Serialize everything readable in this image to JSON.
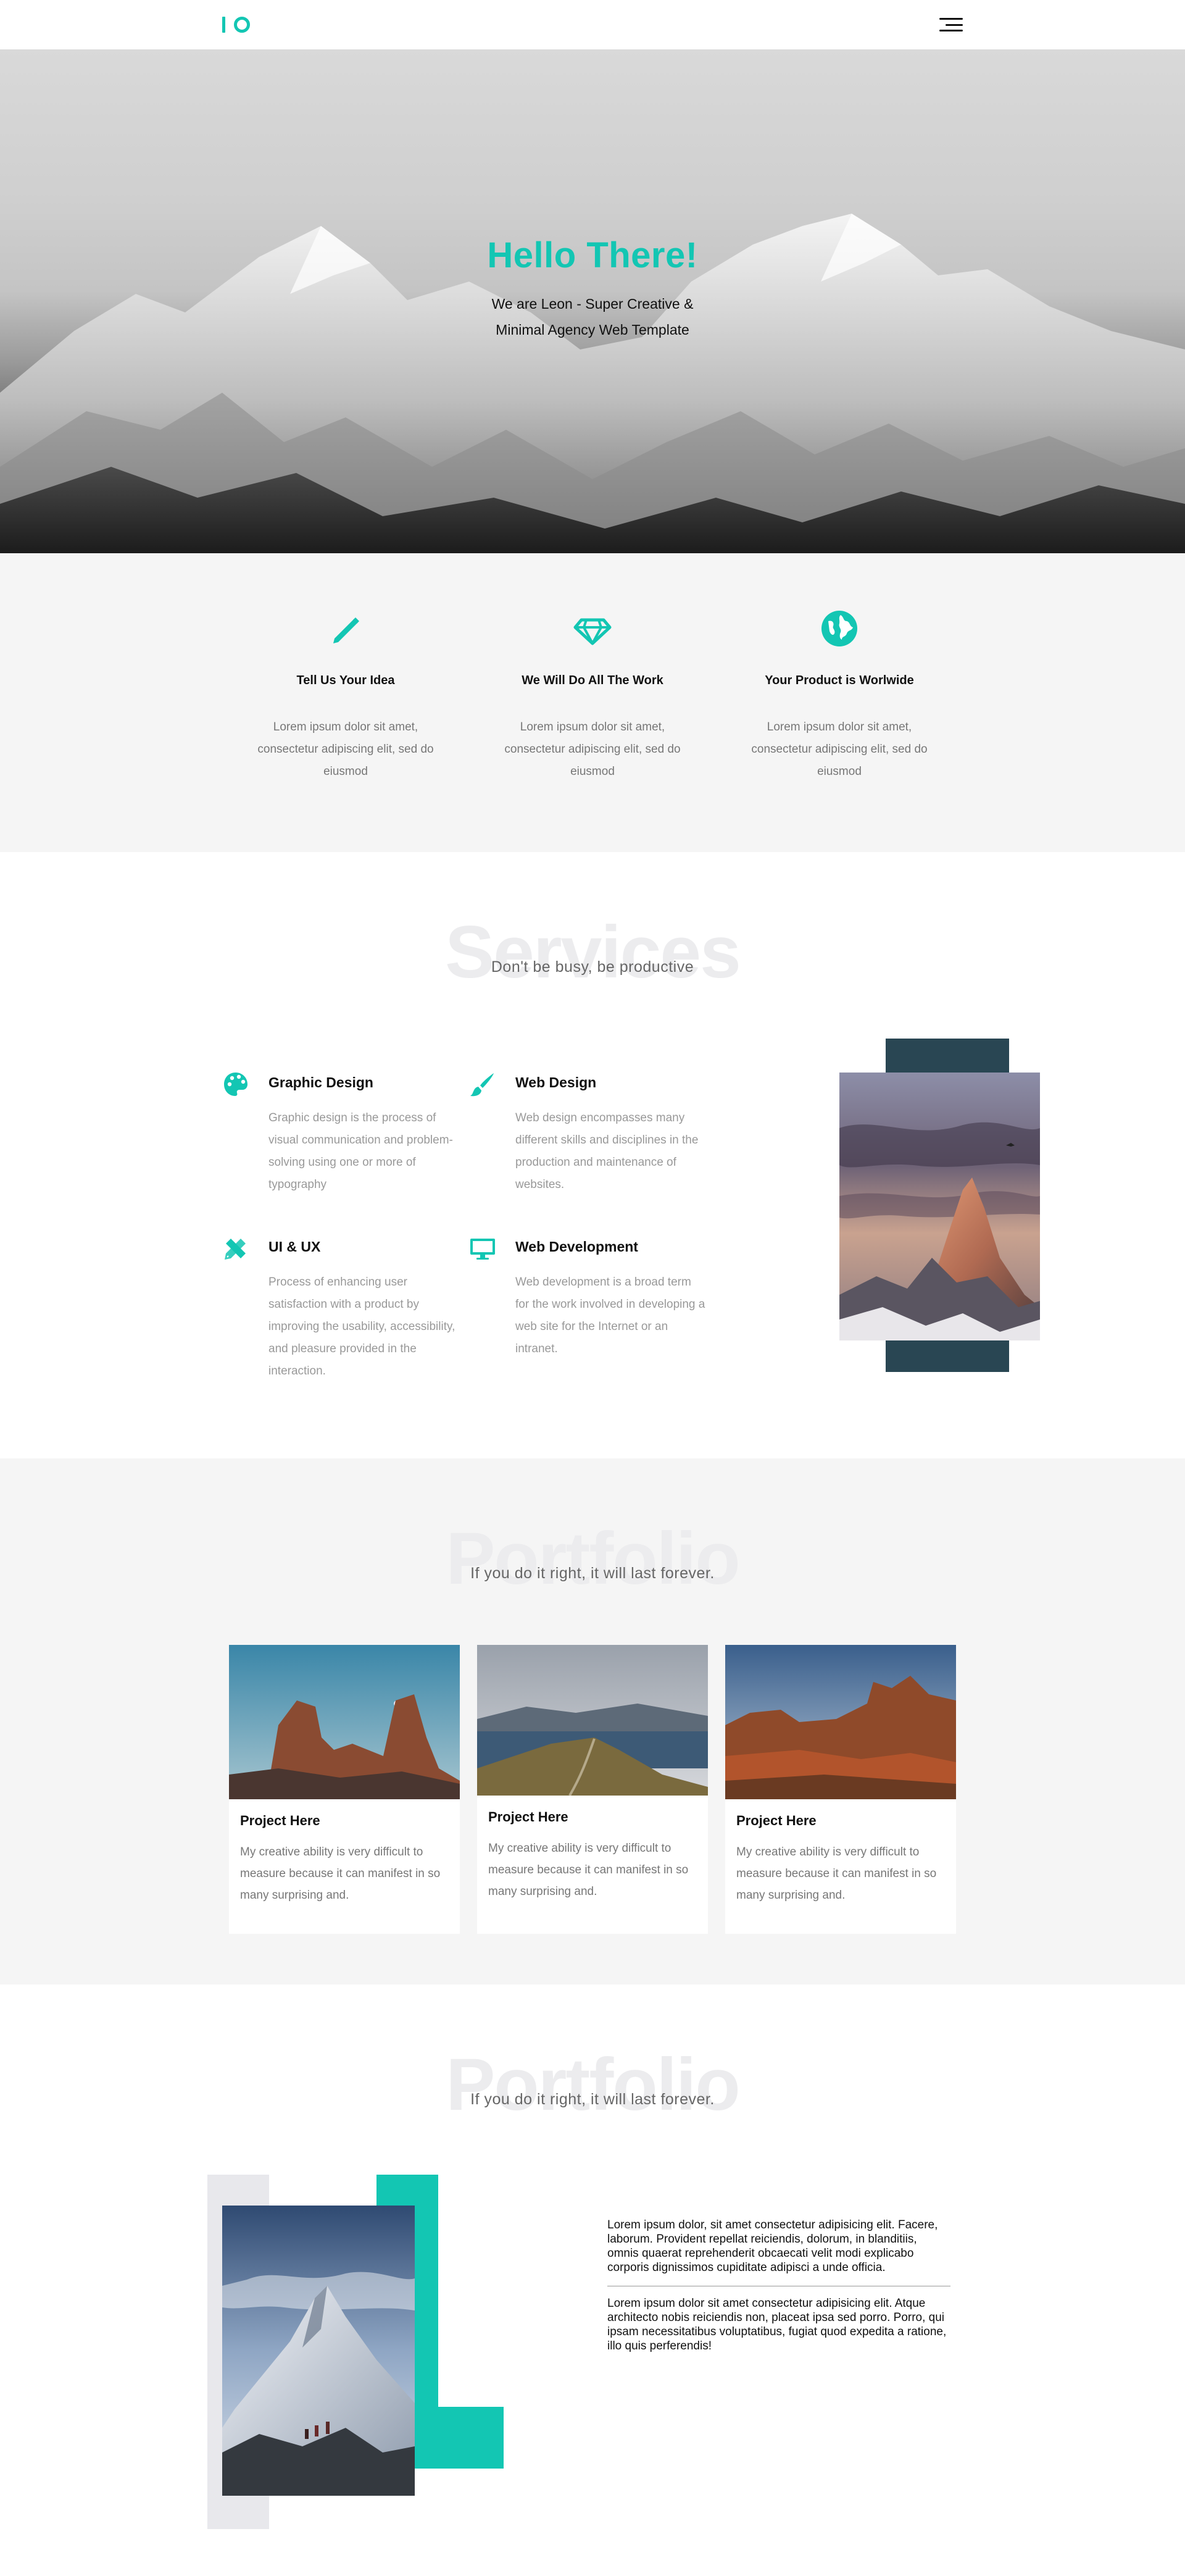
{
  "hero": {
    "title": "Hello There!",
    "subtitle": "We are Leon - Super Creative & Minimal Agency Web Template"
  },
  "features": [
    {
      "icon": "pencil-icon",
      "title": "Tell Us Your Idea",
      "text": "Lorem ipsum dolor sit amet, consectetur adipiscing elit, sed do eiusmod"
    },
    {
      "icon": "diamond-icon",
      "title": "We Will Do All The Work",
      "text": "Lorem ipsum dolor sit amet, consectetur adipiscing elit, sed do eiusmod"
    },
    {
      "icon": "globe-icon",
      "title": "Your Product is Worlwide",
      "text": "Lorem ipsum dolor sit amet, consectetur adipiscing elit, sed do eiusmod"
    }
  ],
  "services": {
    "heading": "Services",
    "subheading": "Don't be busy, be productive",
    "items": [
      {
        "icon": "palette-icon",
        "title": "Graphic Design",
        "text": "Graphic design is the process of visual communication and problem-solving using one or more of typography"
      },
      {
        "icon": "brush-icon",
        "title": "Web Design",
        "text": "Web design encompasses many different skills and disciplines in the production and maintenance of websites."
      },
      {
        "icon": "pencil-ruler-icon",
        "title": "UI & UX",
        "text": "Process of enhancing user satisfaction with a product by improving the usability, accessibility, and pleasure provided in the interaction."
      },
      {
        "icon": "desktop-icon",
        "title": "Web Development",
        "text": "Web development is a broad term for the work involved in developing a web site for the Internet or an intranet."
      }
    ]
  },
  "portfolio": {
    "heading": "Portfolio",
    "subheading": "If you do it right, it will last forever.",
    "cards": [
      {
        "title": "Project Here",
        "text": "My creative ability is very difficult to measure because it can manifest in so many surprising and."
      },
      {
        "title": "Project Here",
        "text": "My creative ability is very difficult to measure because it can manifest in so many surprising and."
      },
      {
        "title": "Project Here",
        "text": "My creative ability is very difficult to measure because it can manifest in so many surprising and."
      }
    ]
  },
  "portfolio2": {
    "heading": "Portfolio",
    "subheading": "If you do it right, it will last forever.",
    "paragraph1": "Lorem ipsum dolor, sit amet consectetur adipisicing elit. Facere, laborum. Provident repellat reiciendis, dolorum, in blanditiis, omnis quaerat reprehenderit obcaecati velit modi explicabo corporis dignissimos cupiditate adipisci a unde officia.",
    "paragraph2": "Lorem ipsum dolor sit amet consectetur adipisicing elit. Atque architecto nobis reiciendis non, placeat ipsa sed porro. Porro, qui ipsam necessitatibus voluptatibus, fugiat quod expedita a ratione, illo quis perferendis!"
  },
  "colors": {
    "accent": "#13c6b3",
    "dark_panel": "#294653",
    "section_grey": "#f5f5f5"
  }
}
